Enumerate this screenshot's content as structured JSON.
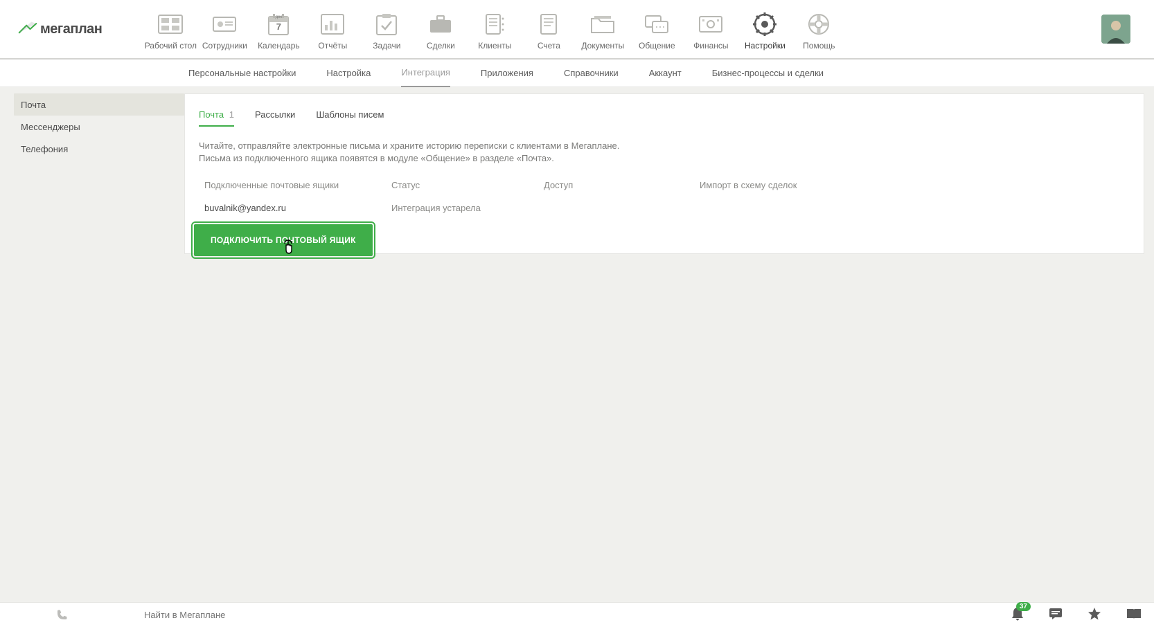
{
  "logo_text": "мегаплан",
  "top_nav": [
    {
      "label": "Рабочий стол"
    },
    {
      "label": "Сотрудники"
    },
    {
      "label": "Календарь",
      "calendar_month": "дек",
      "calendar_day": "7"
    },
    {
      "label": "Отчёты"
    },
    {
      "label": "Задачи"
    },
    {
      "label": "Сделки"
    },
    {
      "label": "Клиенты"
    },
    {
      "label": "Счета"
    },
    {
      "label": "Документы"
    },
    {
      "label": "Общение"
    },
    {
      "label": "Финансы"
    },
    {
      "label": "Настройки"
    },
    {
      "label": "Помощь"
    }
  ],
  "sub_nav": [
    {
      "label": "Персональные настройки"
    },
    {
      "label": "Настройка"
    },
    {
      "label": "Интеграция",
      "active": true
    },
    {
      "label": "Приложения"
    },
    {
      "label": "Справочники"
    },
    {
      "label": "Аккаунт"
    },
    {
      "label": "Бизнес-процессы и сделки"
    }
  ],
  "sidebar": {
    "items": [
      {
        "label": "Почта",
        "active": true
      },
      {
        "label": "Мессенджеры"
      },
      {
        "label": "Телефония"
      }
    ]
  },
  "inner_tabs": [
    {
      "label": "Почта",
      "badge": "1",
      "active": true
    },
    {
      "label": "Рассылки"
    },
    {
      "label": "Шаблоны писем"
    }
  ],
  "description": {
    "line1": "Читайте, отправляйте электронные письма и храните историю переписки с клиентами в Мегаплане.",
    "line2": "Письма из подключенного ящика появятся в модуле «Общение» в разделе «Почта»."
  },
  "table": {
    "headers": {
      "email": "Подключенные почтовые ящики",
      "status": "Статус",
      "access": "Доступ",
      "import": "Импорт в схему сделок"
    },
    "rows": [
      {
        "email": "buvalnik@yandex.ru",
        "status": "Интеграция устарела",
        "access": "",
        "import": ""
      }
    ]
  },
  "connect_button": "ПОДКЛЮЧИТЬ ПОЧТОВЫЙ ЯЩИК",
  "bottom": {
    "search_placeholder": "Найти в Мегаплане",
    "bell_count": "37"
  }
}
